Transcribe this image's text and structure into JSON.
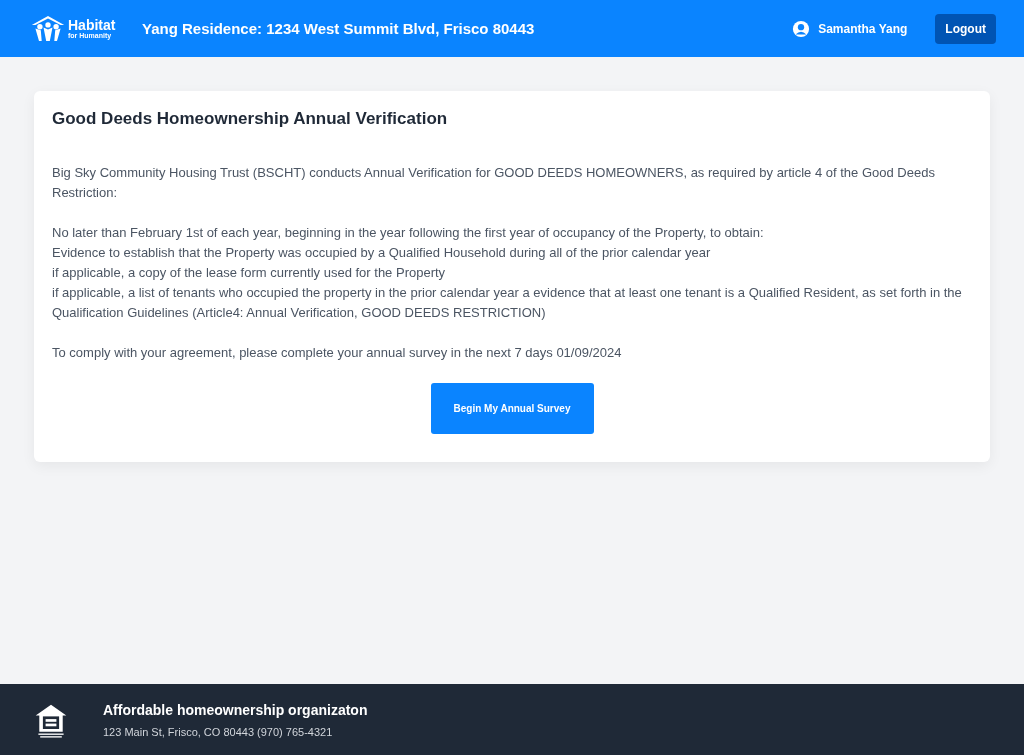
{
  "header": {
    "logo": {
      "name": "Habitat",
      "tagline": "for Humanity"
    },
    "residence": "Yang Residence: 1234 West Summit Blvd, Frisco 80443",
    "user": "Samantha Yang",
    "logout": "Logout"
  },
  "card": {
    "title": "Good Deeds Homeownership Annual Verification",
    "paragraphs": [
      [
        "Big Sky Community Housing Trust (BSCHT) conducts Annual Verification for GOOD DEEDS HOMEOWNERS, as required by article 4 of the Good Deeds Restriction:"
      ],
      [
        "No later than February 1st of each year, beginning in the year following the first year of occupancy of the Property, to obtain:",
        "Evidence to establish that the Property was occupied by a Qualified Household during all of the prior calendar year",
        "if applicable, a copy of the lease form currently used for the Property",
        "if applicable, a list of tenants who occupied the property in the prior calendar year a evidence that at least one tenant is a Qualified Resident, as set forth in the Qualification Guidelines (Article4: Annual Verification, GOOD DEEDS RESTRICTION)"
      ],
      [
        "To comply with your agreement, please complete your annual survey in the next 7 days 01/09/2024"
      ]
    ],
    "button": "Begin My Annual Survey"
  },
  "footer": {
    "title": "Affordable homeownership organizaton",
    "address": "123 Main St, Frisco, CO 80443 (970) 765-4321"
  }
}
